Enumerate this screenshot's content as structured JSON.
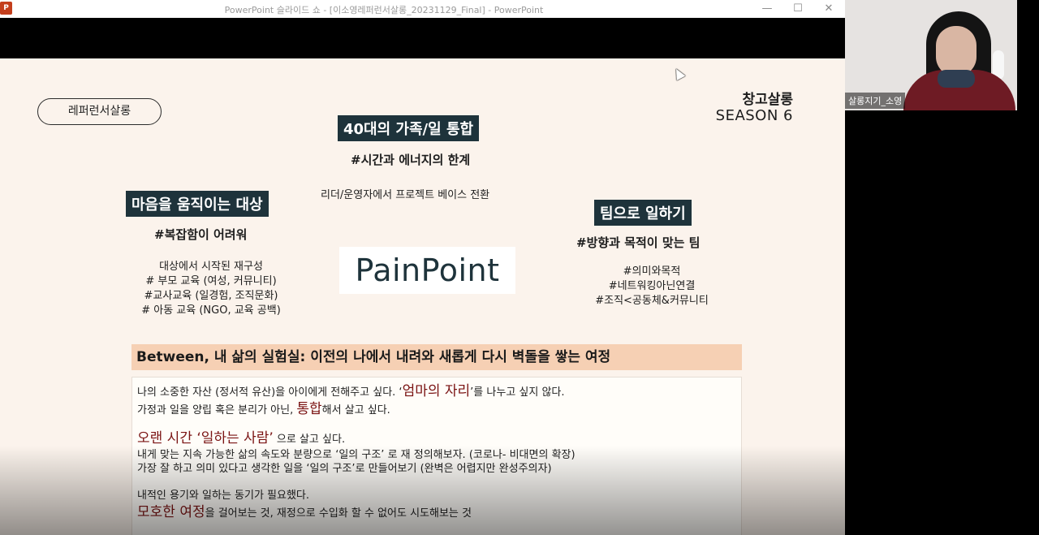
{
  "window": {
    "app_icon": "P",
    "title": "PowerPoint 슬라이드 쇼 - [이소영레퍼런서살롱_20231129_Final] - PowerPoint",
    "minimize": "—",
    "maximize": "☐",
    "close": "✕"
  },
  "slide": {
    "pill": "레퍼런서살롱",
    "season_title": "창고살롱",
    "season_sub": "SEASON 6",
    "center": {
      "label": "40대의 가족/일 통합",
      "hashtag": "#시간과 에너지의 한계",
      "text": "리더/운영자에서 프로젝트 베이스 전환"
    },
    "left": {
      "label": "마음을 움직이는 대상",
      "hashtag": "#복잡함이 어려워",
      "items": [
        "대상에서 시작된 재구성",
        "# 부모 교육 (여성, 커뮤니티)",
        "#교사교육 (일경험, 조직문화)",
        "# 아동 교육 (NGO, 교육 공백)"
      ]
    },
    "logo": "PainPoint",
    "right": {
      "label": "팀으로 일하기",
      "hashtag": "#방향과 목적이 맞는 팀",
      "items": [
        "#의미와목적",
        "#네트워킹아닌연결",
        "#조직<공동체&커뮤니티"
      ]
    },
    "between": "Between, 내 삶의 실험실: 이전의 나에서 내려와 새롭게 다시 벽돌을 쌓는 여정",
    "body": {
      "p1_a": "나의 소중한 자산 (정서적 유산)을 아이에게 전해주고 싶다. ‘",
      "p1_red": "엄마의 자리",
      "p1_b": "’를 나누고 싶지 않다.",
      "p2_a": "가정과 일을 양립 혹은 분리가 아닌, ",
      "p2_red": "통합",
      "p2_b": "해서 살고 싶다.",
      "p3_red": "오랜 시간 ‘일하는 사람’",
      "p3_b": " 으로 살고 싶다.",
      "p4": "내게 맞는 지속 가능한 삶의 속도와 분량으로 ‘일의 구조’ 로 재 정의해보자. (코로나- 비대면의 확장)",
      "p5": "가장 잘 하고 의미 있다고 생각한 일을 ‘일의 구조’로 만들어보기 (완벽은 어렵지만 완성주의자)",
      "p6": "내적인 용기와 일하는 동기가 필요했다.",
      "p7_red": "모호한 여정",
      "p7_b": "을 걸어보는 것, 재정으로 수입화 할 수 없어도 시도해보는 것"
    }
  },
  "webcam": {
    "name": "살롱지기_소영"
  },
  "colors": {
    "slide_bg": "#fbf3ec",
    "dark_label": "#1e333b",
    "highlight_bar": "#f6d0b4",
    "accent_red": "#7a1313"
  }
}
